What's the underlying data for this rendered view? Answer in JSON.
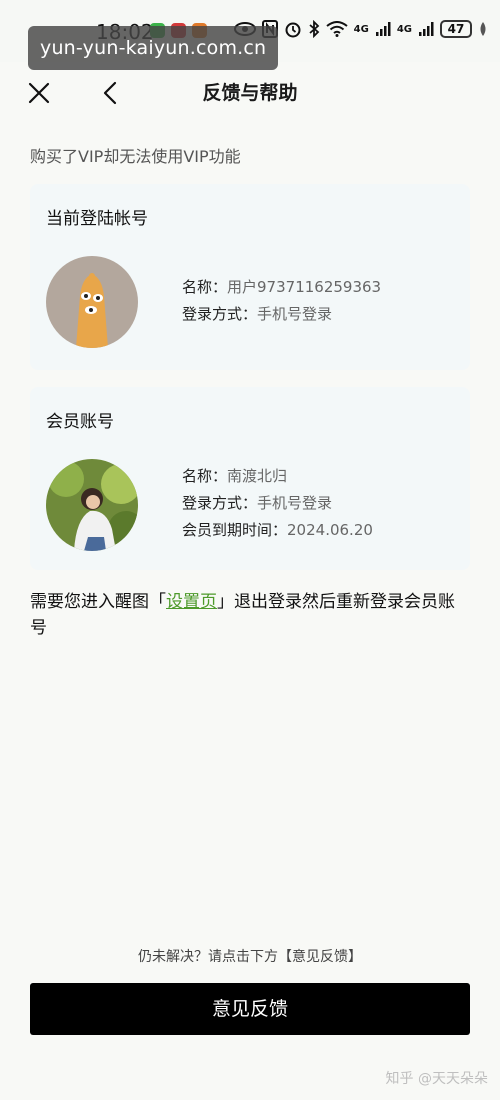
{
  "status_bar": {
    "time": "18:02",
    "network_1": "4G",
    "network_2": "4G",
    "battery": "47"
  },
  "watermark_top": "yun-yun-kaiyun.com.cn",
  "header": {
    "title": "反馈与帮助"
  },
  "subtitle": "购买了VIP却无法使用VIP功能",
  "current_account": {
    "title": "当前登陆帐号",
    "name_label": "名称：",
    "name_value": "用户9737116259363",
    "login_label": "登录方式：",
    "login_value": "手机号登录"
  },
  "member_account": {
    "title": "会员账号",
    "name_label": "名称：",
    "name_value": "南渡北归",
    "login_label": "登录方式：",
    "login_value": "手机号登录",
    "expiry_label": "会员到期时间：",
    "expiry_value": "2024.06.20"
  },
  "note": {
    "before": "需要您进入醒图「",
    "link": "设置页",
    "after": "」退出登录然后重新登录会员账号"
  },
  "hint": "仍未解决？请点击下方【意见反馈】",
  "feedback_button": "意见反馈",
  "watermark_bottom": "知乎 @天天朵朵",
  "colors": {
    "background": "#f8f9f6",
    "card": "#f3f8f9",
    "link": "#4d9a2a",
    "button": "#000000"
  }
}
